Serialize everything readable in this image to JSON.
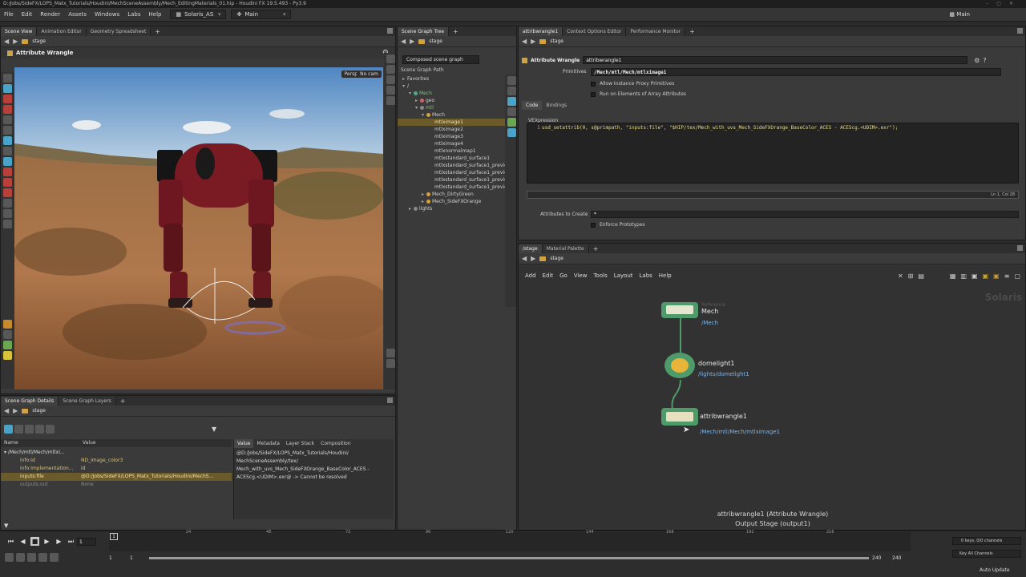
{
  "window": {
    "path": "D:/Jobs/SideFX/LOPS_Matx_Tutorials/Houdini/MechSceneAssembly/Mech_EditingMaterials_01.hip",
    "app": "Houdini FX 19.5.493 - Py3.9"
  },
  "menubar": {
    "items": [
      "File",
      "Edit",
      "Render",
      "Assets",
      "Windows",
      "Labs",
      "Help"
    ],
    "desktop": "Solaris_AS",
    "context": "Main",
    "right_context": "Main"
  },
  "viewer_pane": {
    "tabs": [
      "Scene View",
      "Animation Editor",
      "Geometry Spreadsheet"
    ],
    "path": "stage",
    "node_header": "Attribute Wrangle",
    "camera_menu": "Persp",
    "cam_menu": "No cam"
  },
  "scene_graph_pane": {
    "tab": "Scene Graph Tree",
    "path": "stage",
    "mode": "Composed scene graph",
    "column": "Scene Graph Path",
    "rows": [
      {
        "label": "Favorites",
        "indent": 0
      },
      {
        "label": "/",
        "indent": 0
      },
      {
        "label": "Mech",
        "indent": 1
      },
      {
        "label": "geo",
        "indent": 2
      },
      {
        "label": "mtl",
        "indent": 2
      },
      {
        "label": "Mech",
        "indent": 3
      },
      {
        "label": "mtlximage1",
        "indent": 4
      },
      {
        "label": "mtlximage2",
        "indent": 4
      },
      {
        "label": "mtlximage3",
        "indent": 4
      },
      {
        "label": "mtlximage4",
        "indent": 4
      },
      {
        "label": "mtlxnormalmap1",
        "indent": 4
      },
      {
        "label": "mtlxstandard_surface1",
        "indent": 4
      },
      {
        "label": "mtlxstandard_surface1_preview",
        "indent": 4
      },
      {
        "label": "mtlxstandard_surface1_preview_te",
        "indent": 4
      },
      {
        "label": "mtlxstandard_surface1_preview_te",
        "indent": 4
      },
      {
        "label": "mtlxstandard_surface1_preview_u",
        "indent": 4
      },
      {
        "label": "Mech_DirtyGreen",
        "indent": 3
      },
      {
        "label": "Mech_SideFXOrange",
        "indent": 3
      },
      {
        "label": "lights",
        "indent": 1
      }
    ]
  },
  "params_pane": {
    "tabs": [
      "attribwrangle1",
      "Context Options Editor",
      "Performance Monitor"
    ],
    "path": "stage",
    "node_type": "Attribute Wrangle",
    "node_name": "attribwrangle1",
    "primitives_label": "Primitives",
    "primitives_value": "/Mech/mtl/Mech/mtlximage1",
    "allow_proxy": "Allow Instance Proxy Primitives",
    "run_elements": "Run on Elements of Array Attributes",
    "subtabs": [
      "Code",
      "Bindings"
    ],
    "vex_label": "VEXpression",
    "line_no": "1",
    "code": "usd_setattrib(0, s@primpath, \"inputs:file\", \"$HIP/tex/Mech_with_uvs_Mech_SideFXOrange_BaseColor_ACES - ACEScg.<UDIM>.exr\");",
    "cursor": "Ln 1, Col 28",
    "attr_create_label": "Attributes to Create",
    "attr_create_value": "*",
    "enforce": "Enforce Prototypes"
  },
  "network_pane": {
    "tabs": [
      "/stage",
      "Material Palette"
    ],
    "path": "stage",
    "menu": [
      "Add",
      "Edit",
      "Go",
      "View",
      "Tools",
      "Layout",
      "Labs",
      "Help"
    ],
    "watermark": "Solaris",
    "nodes": [
      {
        "name": "Mech",
        "path": "/Mech",
        "flag": "Reference"
      },
      {
        "name": "domelight1",
        "path": "/lights/domelight1"
      },
      {
        "name": "attribwrangle1",
        "path": "/Mech/mtl/Mech/mtlximage1"
      }
    ],
    "footer_line1": "attribwrangle1 (Attribute Wrangle)",
    "footer_line2": "Output Stage (output1)"
  },
  "details_pane": {
    "tabs": [
      "Scene Graph Details",
      "Scene Graph Layers"
    ],
    "path": "stage",
    "col_name": "Name",
    "col_value": "Value",
    "prim_path": "/Mech/mtl/Mech/mtlxi...",
    "rows": [
      {
        "name": "info:id",
        "value": "ND_image_color3"
      },
      {
        "name": "info:implementation...",
        "value": "id"
      },
      {
        "name": "inputs:file",
        "value": "@D:/Jobs/SideFX/LOPS_Matx_Tutorials/Houdini/MechS..."
      },
      {
        "name": "outputs:out",
        "value": "None"
      }
    ],
    "value_tabs": [
      "Value",
      "Metadata",
      "Layer Stack",
      "Composition"
    ],
    "value_text": "@D:/Jobs/SideFX/LOPS_Matx_Tutorials/Houdini/ MechSceneAssembly/tex/ Mech_with_uvs_Mech_SideFXOrange_BaseColor_ACES - ACEScg.<UDIM>.exr@ -> Cannot be resolved"
  },
  "timeline": {
    "ticks": [
      "24",
      "48",
      "72",
      "96",
      "120",
      "144",
      "168",
      "192",
      "216"
    ],
    "marker": "1",
    "current_frame": "1",
    "start": "1",
    "start2": "1",
    "end": "240",
    "end2": "240",
    "keys": "0 keys, 0/0 channels",
    "key_all": "Key All Channels",
    "auto_update": "Auto Update"
  },
  "colors": {
    "accent_selected": "#6b5a2a",
    "path_blue": "#7fb2e0",
    "node_green": "#4e9a6a",
    "folder": "#d4a23c"
  }
}
